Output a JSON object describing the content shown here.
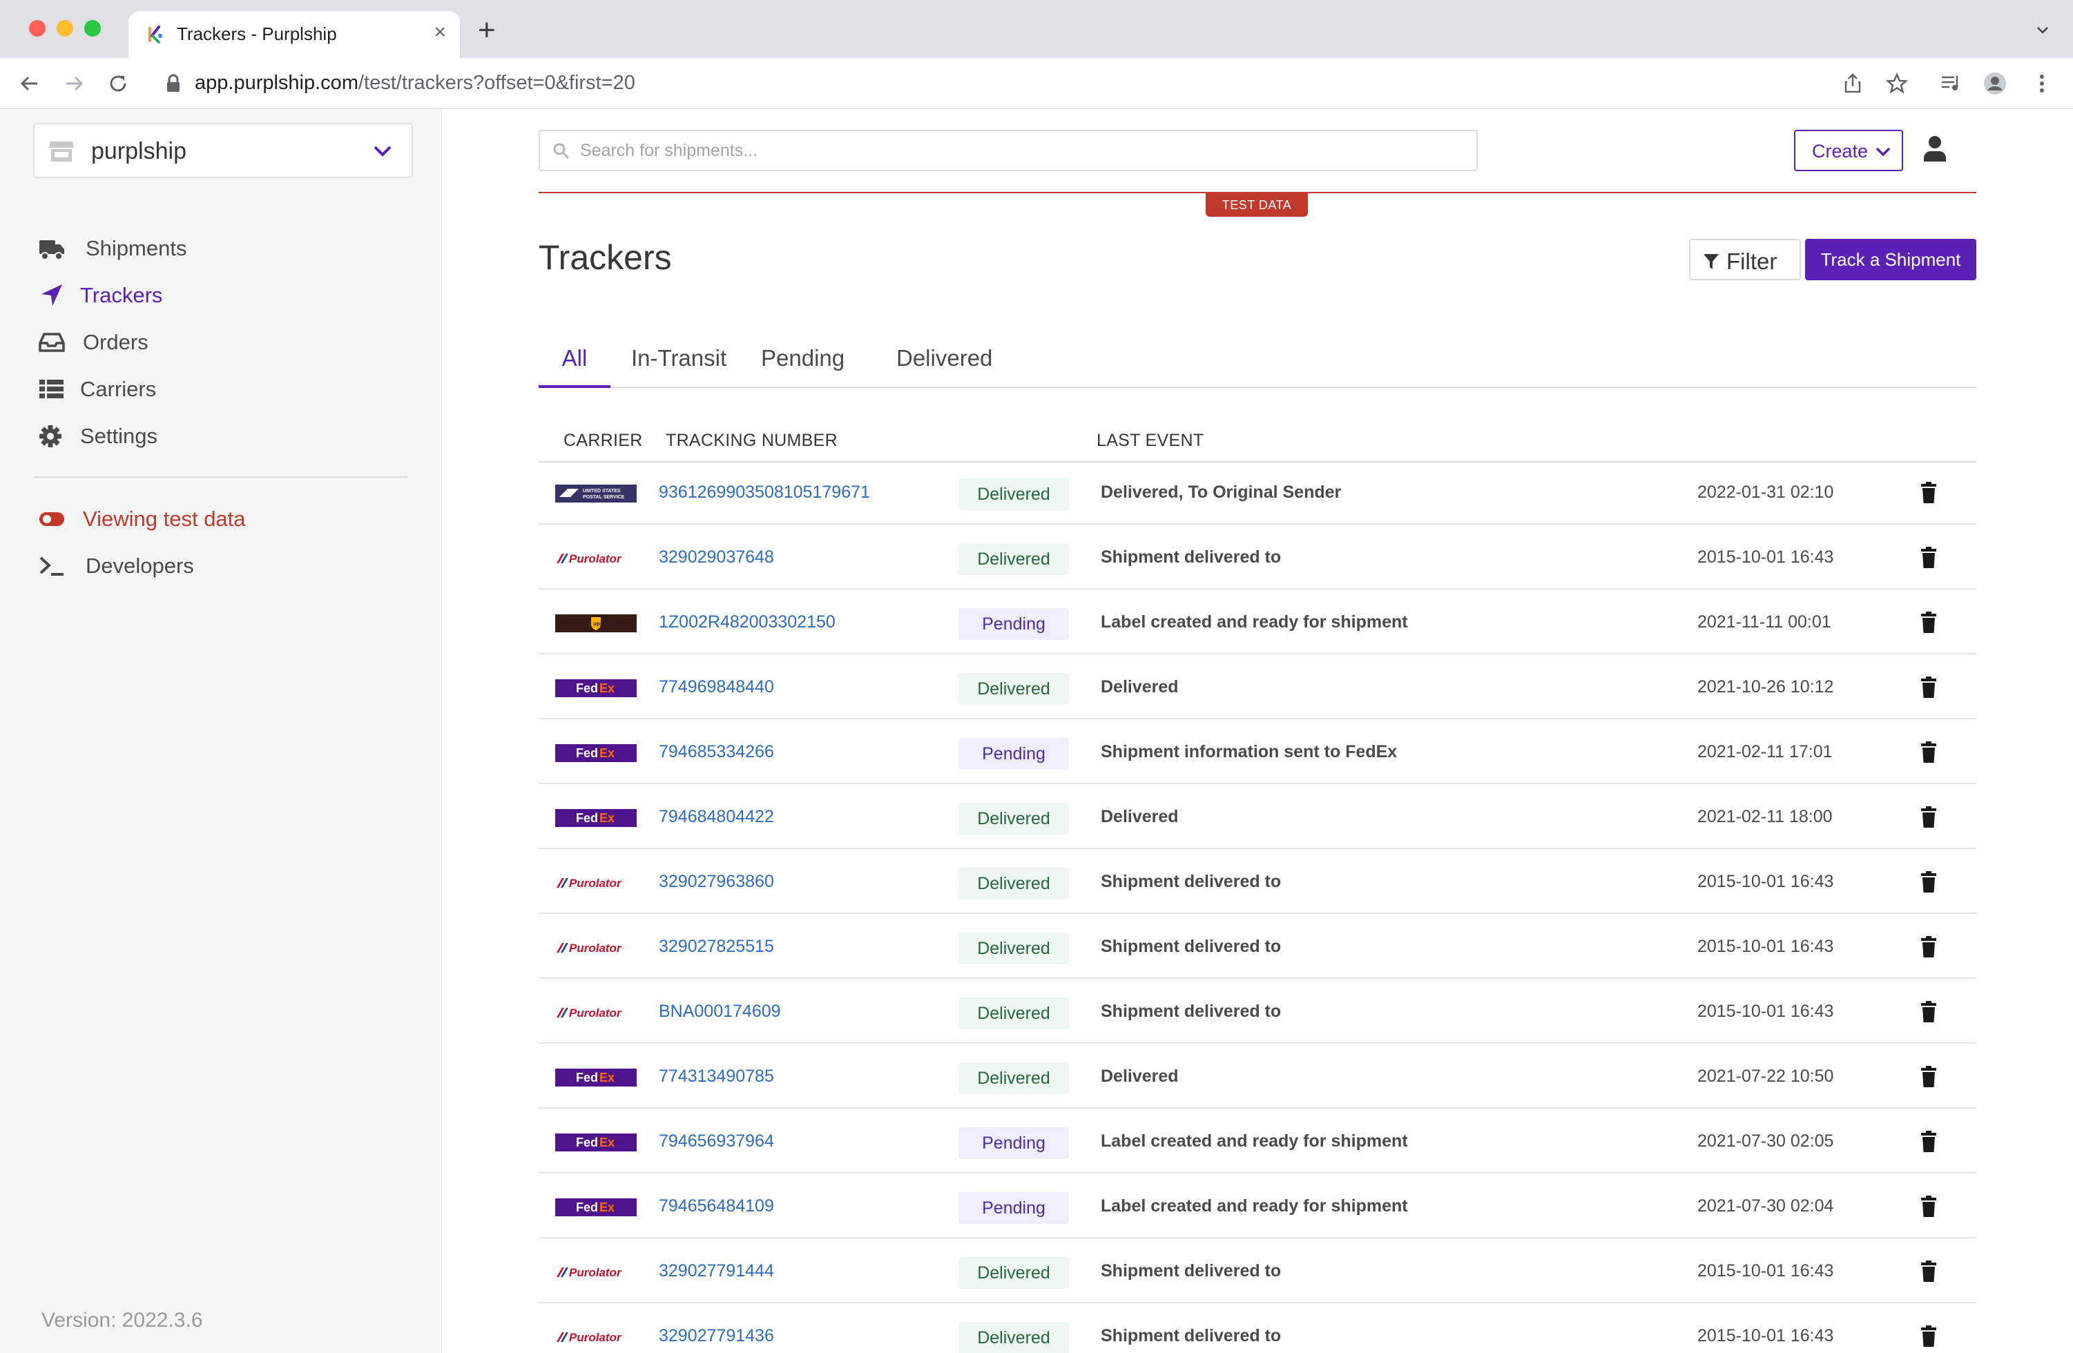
{
  "browser": {
    "tab_title": "Trackers - Purplship",
    "url_host": "app.purplship.com",
    "url_path": "/test/trackers?offset=0&first=20"
  },
  "sidebar": {
    "org_name": "purplship",
    "items": [
      {
        "label": "Shipments",
        "icon": "truck-icon"
      },
      {
        "label": "Trackers",
        "icon": "location-arrow-icon",
        "active": true
      },
      {
        "label": "Orders",
        "icon": "inbox-icon"
      },
      {
        "label": "Carriers",
        "icon": "list-icon"
      },
      {
        "label": "Settings",
        "icon": "gear-icon"
      }
    ],
    "test_mode_label": "Viewing test data",
    "developers_label": "Developers",
    "version": "Version: 2022.3.6"
  },
  "header": {
    "search_placeholder": "Search for shipments...",
    "create_label": "Create",
    "test_badge": "TEST DATA"
  },
  "page": {
    "title": "Trackers",
    "filter_label": "Filter",
    "track_label": "Track a Shipment",
    "tabs": [
      "All",
      "In-Transit",
      "Pending",
      "Delivered"
    ],
    "active_tab": "All"
  },
  "table": {
    "headers": {
      "carrier": "CARRIER",
      "tracking": "TRACKING NUMBER",
      "event": "LAST EVENT"
    },
    "rows": [
      {
        "carrier": "usps",
        "tracking": "9361269903508105179671",
        "status": "Delivered",
        "event": "Delivered, To Original Sender",
        "date": "2022-01-31 02:10"
      },
      {
        "carrier": "purolator",
        "tracking": "329029037648",
        "status": "Delivered",
        "event": "Shipment delivered to",
        "date": "2015-10-01 16:43"
      },
      {
        "carrier": "ups",
        "tracking": "1Z002R482003302150",
        "status": "Pending",
        "event": "Label created and ready for shipment",
        "date": "2021-11-11 00:01"
      },
      {
        "carrier": "fedex",
        "tracking": "774969848440",
        "status": "Delivered",
        "event": "Delivered",
        "date": "2021-10-26 10:12"
      },
      {
        "carrier": "fedex",
        "tracking": "794685334266",
        "status": "Pending",
        "event": "Shipment information sent to FedEx",
        "date": "2021-02-11 17:01"
      },
      {
        "carrier": "fedex",
        "tracking": "794684804422",
        "status": "Delivered",
        "event": "Delivered",
        "date": "2021-02-11 18:00"
      },
      {
        "carrier": "purolator",
        "tracking": "329027963860",
        "status": "Delivered",
        "event": "Shipment delivered to",
        "date": "2015-10-01 16:43"
      },
      {
        "carrier": "purolator",
        "tracking": "329027825515",
        "status": "Delivered",
        "event": "Shipment delivered to",
        "date": "2015-10-01 16:43"
      },
      {
        "carrier": "purolator",
        "tracking": "BNA000174609",
        "status": "Delivered",
        "event": "Shipment delivered to",
        "date": "2015-10-01 16:43"
      },
      {
        "carrier": "fedex",
        "tracking": "774313490785",
        "status": "Delivered",
        "event": "Delivered",
        "date": "2021-07-22 10:50"
      },
      {
        "carrier": "fedex",
        "tracking": "794656937964",
        "status": "Pending",
        "event": "Label created and ready for shipment",
        "date": "2021-07-30 02:05"
      },
      {
        "carrier": "fedex",
        "tracking": "794656484109",
        "status": "Pending",
        "event": "Label created and ready for shipment",
        "date": "2021-07-30 02:04"
      },
      {
        "carrier": "purolator",
        "tracking": "329027791444",
        "status": "Delivered",
        "event": "Shipment delivered to",
        "date": "2015-10-01 16:43"
      },
      {
        "carrier": "purolator",
        "tracking": "329027791436",
        "status": "Delivered",
        "event": "Shipment delivered to",
        "date": "2015-10-01 16:43"
      }
    ]
  },
  "colors": {
    "accent": "#5b21b6",
    "test": "#c0392b",
    "link": "#2d6bc4"
  }
}
